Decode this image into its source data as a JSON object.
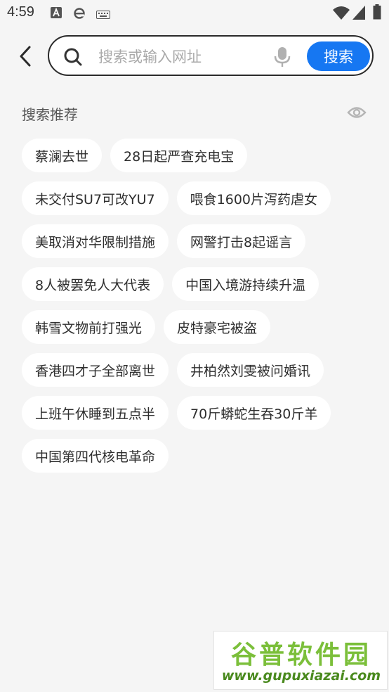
{
  "status_bar": {
    "time": "4:59",
    "left_icons": [
      "text-a-icon",
      "ie-browser-icon",
      "keyboard-icon"
    ],
    "right_icons": [
      "wifi-icon",
      "signal-icon",
      "battery-icon"
    ]
  },
  "search": {
    "placeholder": "搜索或输入网址",
    "value": "",
    "button_label": "搜索",
    "accent_color": "#1677f2"
  },
  "recommend": {
    "title": "搜索推荐",
    "tags": [
      "蔡澜去世",
      "28日起严查充电宝",
      "未交付SU7可改YU7",
      "喂食1600片泻药虐女",
      "美取消对华限制措施",
      "网警打击8起谣言",
      "8人被罢免人大代表",
      "中国入境游持续升温",
      "韩雪文物前打强光",
      "皮特豪宅被盗",
      "香港四才子全部离世",
      "井柏然刘雯被问婚讯",
      "上班午休睡到五点半",
      "70斤蟒蛇生吞30斤羊",
      "中国第四代核电革命"
    ]
  },
  "watermark": {
    "title": "谷普软件园",
    "url": "www.gupuxiazai.com"
  }
}
